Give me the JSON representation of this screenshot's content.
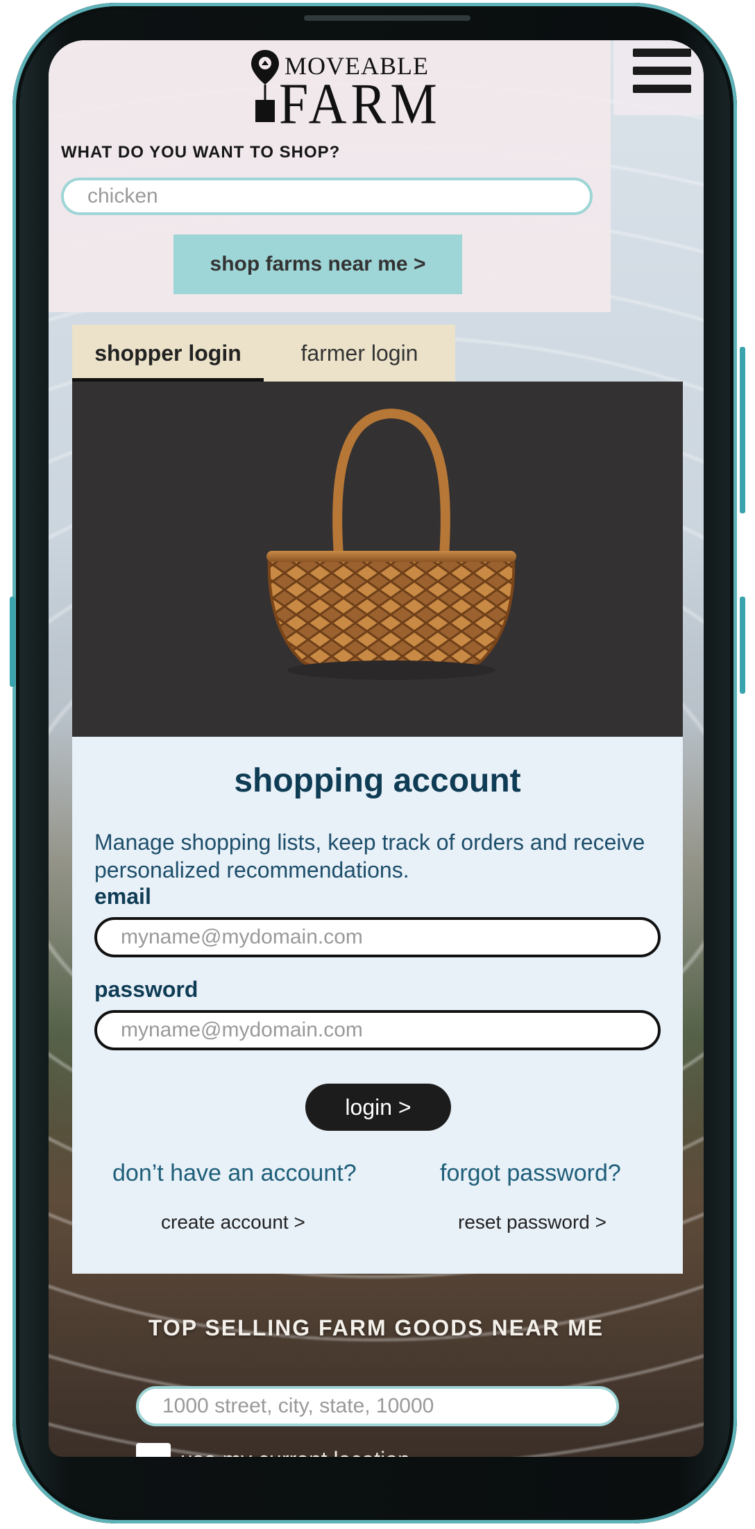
{
  "header": {
    "logo_line1": "MOVEABLE",
    "logo_line2": "FARM",
    "menu_icon": "hamburger-menu-icon"
  },
  "shop": {
    "question": "WHAT DO YOU WANT TO SHOP?",
    "search_value": "chicken",
    "button_label": "shop farms near me >"
  },
  "tabs": [
    {
      "label": "shopper login",
      "active": true
    },
    {
      "label": "farmer login",
      "active": false
    }
  ],
  "account": {
    "title": "shopping account",
    "description": "Manage shopping lists, keep track of orders and receive personalized recommendations.",
    "email_label": "email",
    "email_placeholder": "myname@mydomain.com",
    "password_label": "password",
    "password_placeholder": "myname@mydomain.com",
    "login_label": "login  >",
    "no_account_text": "don’t have an account?",
    "create_account_label": "create account >",
    "forgot_text": "forgot password?",
    "reset_label": "reset password >"
  },
  "bottom": {
    "title": "TOP SELLING FARM GOODS NEAR ME",
    "address_placeholder": "1000 street, city, state, 10000",
    "location_label": "use my current location"
  },
  "colors": {
    "accent_teal": "#9ed5d6",
    "title_navy": "#0f3c55",
    "tab_bg": "#ebe2c9",
    "card_bg": "#e8f0f8",
    "image_bg": "#333132"
  }
}
